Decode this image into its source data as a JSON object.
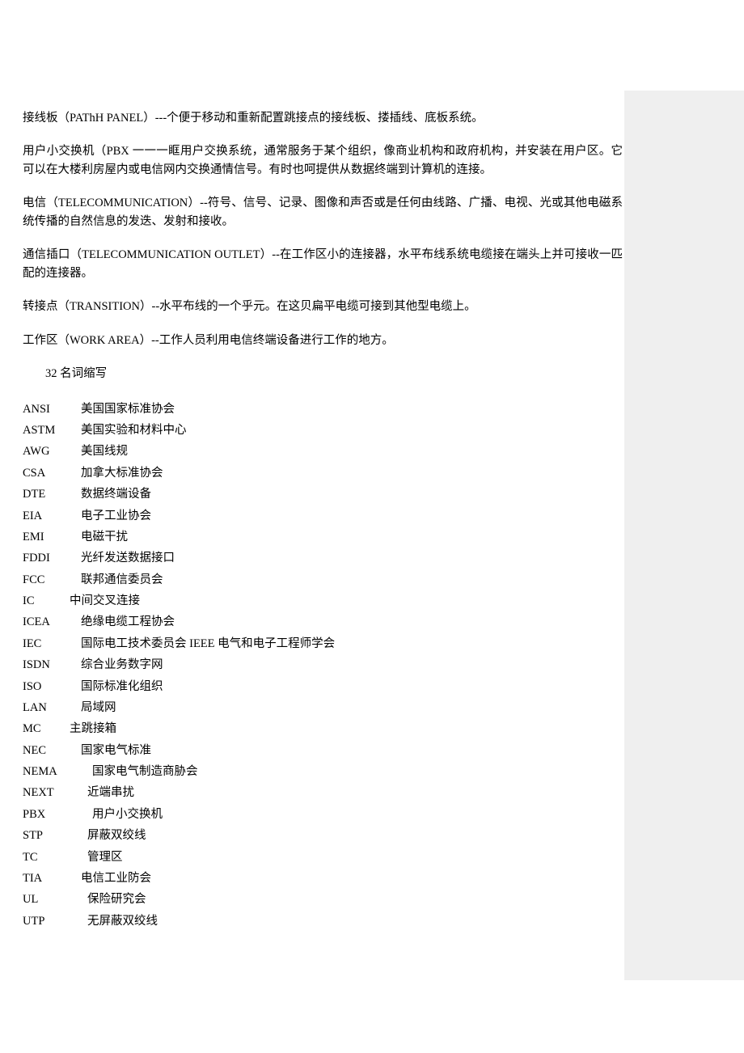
{
  "definitions": [
    "接线板（PAThH PANEL）---个便于移动和重新配置跳接点的接线板、搂插线、底板系统。",
    "用户小交换机（PBX 一一一眶用户交换系统，通常服务于某个组织，像商业机构和政府机构，并安装在用户区。它可以在大楼利房屋内或电信网内交换通情信号。有时也呵提供从数据终端到计算机的连接。",
    "电信（TELECOMMUNICATION）--符号、信号、记录、图像和声否或是任何由线路、广播、电视、光或其他电磁系统传播的自然信息的发迭、发射和接收。",
    "通信插口（TELECOMMUNICATION OUTLET）--在工作区小的连接器，水平布线系统电缆接在端头上并可接收一匹配的连接器。",
    "转接点（TRANSITION）--水平布线的一个乎元。在这贝扁平电缆可接到其他型电缆上。",
    "工作区（WORK AREA）--工作人员利用电信终端设备进行工作的地方。"
  ],
  "section_header": "32 名词缩写",
  "abbreviations": [
    {
      "key": "ANSI",
      "value": "美国国家标准协会"
    },
    {
      "key": "ASTM",
      "value": "美国实验和材料中心"
    },
    {
      "key": "AWG",
      "value": "美国线规"
    },
    {
      "key": "CSA",
      "value": "加拿大标准协会"
    },
    {
      "key": "DTE",
      "value": "数据终端设备"
    },
    {
      "key": "EIA",
      "value": "电子工业协会"
    },
    {
      "key": "EMI",
      "value": "电磁干扰"
    },
    {
      "key": "FDDI",
      "value": "光纤发送数据接口"
    },
    {
      "key": "FCC",
      "value": "联邦通信委员会"
    },
    {
      "key": "IC",
      "value": "中间交叉连接"
    },
    {
      "key": "ICEA",
      "value": "绝缘电缆工程协会"
    },
    {
      "key": "IEC",
      "value": "国际电工技术委员会  IEEE  电气和电子工程师学会"
    },
    {
      "key": "ISDN",
      "value": "综合业务数字网"
    },
    {
      "key": "ISO",
      "value": "国际标准化组织"
    },
    {
      "key": "LAN",
      "value": "局域网"
    },
    {
      "key": "MC",
      "value": "主跳接箱"
    },
    {
      "key": "NEC",
      "value": "国家电气标准"
    },
    {
      "key": "NEMA",
      "value": "国家电气制造商胁会"
    },
    {
      "key": "NEXT",
      "value": "近端串扰"
    },
    {
      "key": "PBX",
      "value": "用户小交换机"
    },
    {
      "key": "STP",
      "value": "屏蔽双绞线"
    },
    {
      "key": "TC",
      "value": "管理区"
    },
    {
      "key": "TIA",
      "value": "电信工业防会"
    },
    {
      "key": "UL",
      "value": "保险研究会"
    },
    {
      "key": "UTP",
      "value": "无屏蔽双绞线"
    }
  ]
}
